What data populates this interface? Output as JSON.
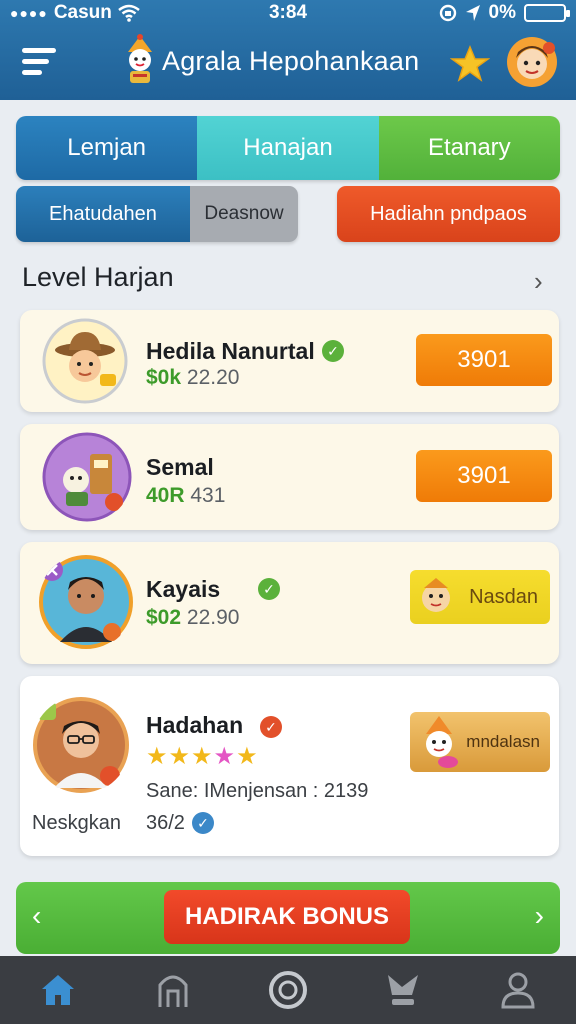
{
  "status_bar": {
    "signal_dots": "●●●●",
    "carrier": "Casun",
    "time": "3:84",
    "battery_text": "0%"
  },
  "header": {
    "title": "Agrala Hepohankaan"
  },
  "tabs": [
    {
      "label": "Lemjan"
    },
    {
      "label": "Hanajan"
    },
    {
      "label": "Etanary"
    }
  ],
  "filters": {
    "left_label": "Ehatudahen",
    "right_label": "Deasnow",
    "reward_button": "Hadiahn pndpaos"
  },
  "section": {
    "title": "Level Harjan"
  },
  "cards": [
    {
      "name": "Hedila Nanurtal",
      "score_prefix": "$0k",
      "score_value": "22.20",
      "action": "3901"
    },
    {
      "name": "Semal",
      "score_prefix": "40R",
      "score_value": "431",
      "action": "3901"
    },
    {
      "name": "Kayais",
      "score_prefix": "$02",
      "score_value": "22.90",
      "action": "Nasdan"
    },
    {
      "name": "Hadahan",
      "stats": "Sane: IMenjensan : 2139",
      "secondary_label": "Neskgkan",
      "secondary_value": "36/2",
      "rating": 5,
      "action": "mndalasn"
    }
  ],
  "bonus": {
    "label": "HADIRAK BONUS",
    "left_arrow": "‹",
    "right_arrow": "›"
  },
  "colors": {
    "header": "#1f6096",
    "tab_blue": "#1e6aa5",
    "tab_teal": "#3cc0c4",
    "tab_green": "#52b13a",
    "orange": "#ef7b07",
    "red": "#d8351a",
    "nav_bg": "#3a3d42",
    "nav_active": "#3b8fd1"
  },
  "nav": [
    {
      "icon": "home-icon",
      "active": true
    },
    {
      "icon": "shop-icon"
    },
    {
      "icon": "target-icon"
    },
    {
      "icon": "trophy-icon"
    },
    {
      "icon": "profile-icon"
    }
  ]
}
